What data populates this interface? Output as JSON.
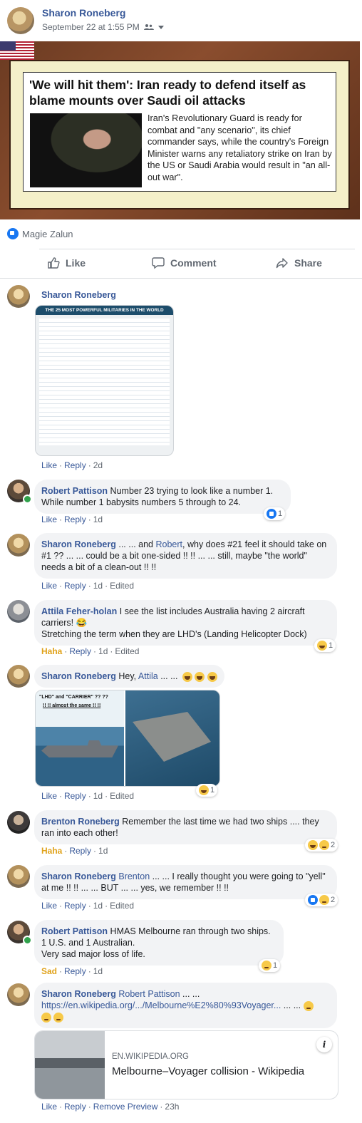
{
  "post": {
    "author": "Sharon Roneberg",
    "timestamp": "September 22 at 1:55 PM",
    "privacy_icon": "friends-icon",
    "reactor": "Magie Zalun",
    "image_headline": "'We will hit them': Iran ready to defend itself as blame mounts over Saudi oil attacks",
    "image_body": "Iran's Revolutionary Guard is ready for combat and \"any scenario\", its chief commander says, while the country's Foreign Minister warns any retaliatory strike on Iran by the US or Saudi Arabia would result in \"an all-out war\"."
  },
  "action_bar": {
    "like": "Like",
    "comment": "Comment",
    "share": "Share"
  },
  "comments": [
    {
      "author": "Sharon Roneberg",
      "image_title": "THE 25 MOST POWERFUL MILITARIES IN THE WORLD",
      "actions": [
        "Like",
        "Reply"
      ],
      "time": "2d"
    },
    {
      "author": "Robert Pattison",
      "text": "Number 23 trying to look like a number 1. While number 1 babysits numbers 5 through to 24.",
      "actions": [
        "Like",
        "Reply"
      ],
      "time": "1d",
      "reaction_count": "1"
    },
    {
      "author": "Sharon Roneberg",
      "text_pre": "... ... and ",
      "mention": "Robert",
      "text_post": ", why does #21 feel it should take on #1 ?? ... ... could be a bit one-sided !! !! ... ... still, maybe \"the world\" needs a bit of a clean-out !! !!",
      "actions": [
        "Like",
        "Reply"
      ],
      "time": "1d",
      "edited": "Edited"
    },
    {
      "author": "Attila Feher-holan",
      "text": "I see the list includes Australia having 2 aircraft carriers! 😂",
      "text2": "Stretching the term when they are LHD's (Landing Helicopter Dock)",
      "actions": [
        "Haha",
        "Reply"
      ],
      "time": "1d",
      "edited": "Edited",
      "reaction_count": "1"
    },
    {
      "author": "Sharon Roneberg",
      "text_pre": "Hey, ",
      "mention": "Attila",
      "text_post": " ... ...",
      "image_caption_1": "\"LHD\" and \"CARRIER\" ?? ??",
      "image_caption_2": "!! !! almost the same !! !!",
      "actions": [
        "Like",
        "Reply"
      ],
      "time": "1d",
      "edited": "Edited",
      "reaction_count": "1"
    },
    {
      "author": "Brenton Roneberg",
      "text": "Remember the last time we had two ships .... they ran into each other!",
      "actions": [
        "Haha",
        "Reply"
      ],
      "time": "1d",
      "reaction_count": "2"
    },
    {
      "author": "Sharon Roneberg",
      "mention": "Brenton",
      "text_post": " ... ... I really thought you were going to \"yell\" at me !! !! ... ... BUT ... ... yes, we remember !! !!",
      "actions": [
        "Like",
        "Reply"
      ],
      "time": "1d",
      "edited": "Edited",
      "reaction_count": "2"
    },
    {
      "author": "Robert Pattison",
      "text": "HMAS Melbourne ran through two ships.",
      "text2": "1 U.S. and 1 Australian.",
      "text3": "Very sad major loss of life.",
      "actions": [
        "Sad",
        "Reply"
      ],
      "time": "1d",
      "reaction_count": "1"
    },
    {
      "author": "Sharon Roneberg",
      "mention": "Robert Pattison",
      "text_post": " ... ...",
      "link": "https://en.wikipedia.org/.../Melbourne%E2%80%93Voyager...",
      "text_after_link": " ... ...",
      "preview_domain": "EN.WIKIPEDIA.ORG",
      "preview_title": "Melbourne–Voyager collision - Wikipedia",
      "actions": [
        "Like",
        "Reply",
        "Remove Preview"
      ],
      "time": "23h"
    }
  ]
}
